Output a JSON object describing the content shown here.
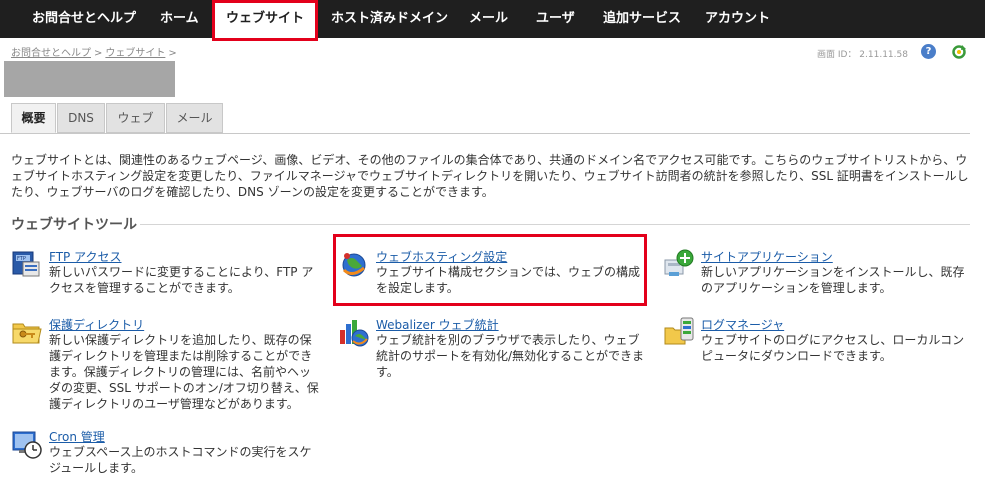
{
  "nav": {
    "items": [
      {
        "label": "お問合せとヘルプ"
      },
      {
        "label": "ホーム"
      },
      {
        "label": "ウェブサイト"
      },
      {
        "label": "ホスト済みドメイン"
      },
      {
        "label": "メール"
      },
      {
        "label": "ユーザ"
      },
      {
        "label": "追加サービス"
      },
      {
        "label": "アカウント"
      }
    ],
    "active": "ウェブサイト"
  },
  "breadcrumb": {
    "items": [
      "お問合せとヘルプ",
      "ウェブサイト"
    ],
    "separator": ">"
  },
  "screen_id": "画面 ID： 2.11.11.58",
  "tabs": [
    {
      "label": "概要"
    },
    {
      "label": "DNS"
    },
    {
      "label": "ウェブ"
    },
    {
      "label": "メール"
    }
  ],
  "description": "ウェブサイトとは、関連性のあるウェブページ、画像、ビデオ、その他のファイルの集合体であり、共通のドメイン名でアクセス可能です。こちらのウェブサイトリストから、ウェブサイトホスティング設定を変更したり、ファイルマネージャでウェブサイトディレクトリを開いたり、ウェブサイト訪問者の統計を参照したり、SSL 証明書をインストールしたり、ウェブサーバのログを確認したり、DNS ゾーンの設定を変更することができます。",
  "section_title": "ウェブサイトツール",
  "tools": [
    {
      "title": "FTP アクセス",
      "desc": "新しいパスワードに変更することにより、FTP アクセスを管理することができます。"
    },
    {
      "title": "ウェブホスティング設定",
      "desc": "ウェブサイト構成セクションでは、ウェブの構成を設定します。"
    },
    {
      "title": "サイトアプリケーション",
      "desc": "新しいアプリケーションをインストールし、既存のアプリケーションを管理します。"
    },
    {
      "title": "保護ディレクトリ",
      "desc": "新しい保護ディレクトリを追加したり、既存の保護ディレクトリを管理または削除することができます。保護ディレクトリの管理には、名前やヘッダの変更、SSL サポートのオン/オフ切り替え、保護ディレクトリのユーザ管理などがあります。"
    },
    {
      "title": "Webalizer ウェブ統計",
      "desc": "ウェブ統計を別のブラウザで表示したり、ウェブ統計のサポートを有効化/無効化することができます。"
    },
    {
      "title": "ログマネージャ",
      "desc": "ウェブサイトのログにアクセスし、ローカルコンピュータにダウンロードできます。"
    },
    {
      "title": "Cron 管理",
      "desc": "ウェブスペース上のホストコマンドの実行をスケジュールします。"
    }
  ],
  "colors": {
    "nav_bg": "#1f1f1f",
    "highlight": "#e3001b",
    "link": "#1b5ca8"
  }
}
